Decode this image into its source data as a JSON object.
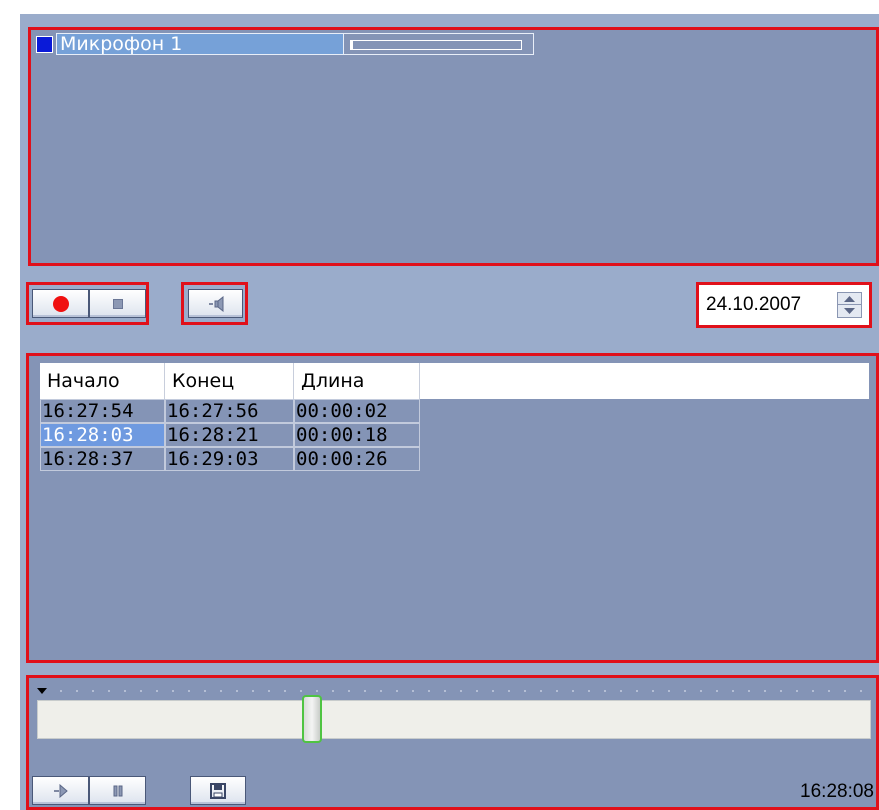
{
  "microphone": {
    "name": "Микрофон 1",
    "level_fraction": 0.01,
    "square_color": "#0a1ad8"
  },
  "controls": {
    "record_icon": "record-icon",
    "stop_icon": "stop-icon",
    "sound_icon": "speaker-icon"
  },
  "date": {
    "value": "24.10.2007"
  },
  "table": {
    "columns": [
      "Начало",
      "Конец",
      "Длина"
    ],
    "rows": [
      {
        "start": "16:27:54",
        "end": "16:27:56",
        "length": "00:00:02"
      },
      {
        "start": "16:28:03",
        "end": "16:28:21",
        "length": "00:00:18"
      },
      {
        "start": "16:28:37",
        "end": "16:29:03",
        "length": "00:00:26"
      }
    ],
    "selected_row": 1
  },
  "timeline": {
    "position_fraction": 0.325,
    "time": "16:28:08"
  },
  "colors": {
    "highlight_frame": "#e0101a",
    "selection": "#6f9ae0",
    "record": "#f01010"
  }
}
